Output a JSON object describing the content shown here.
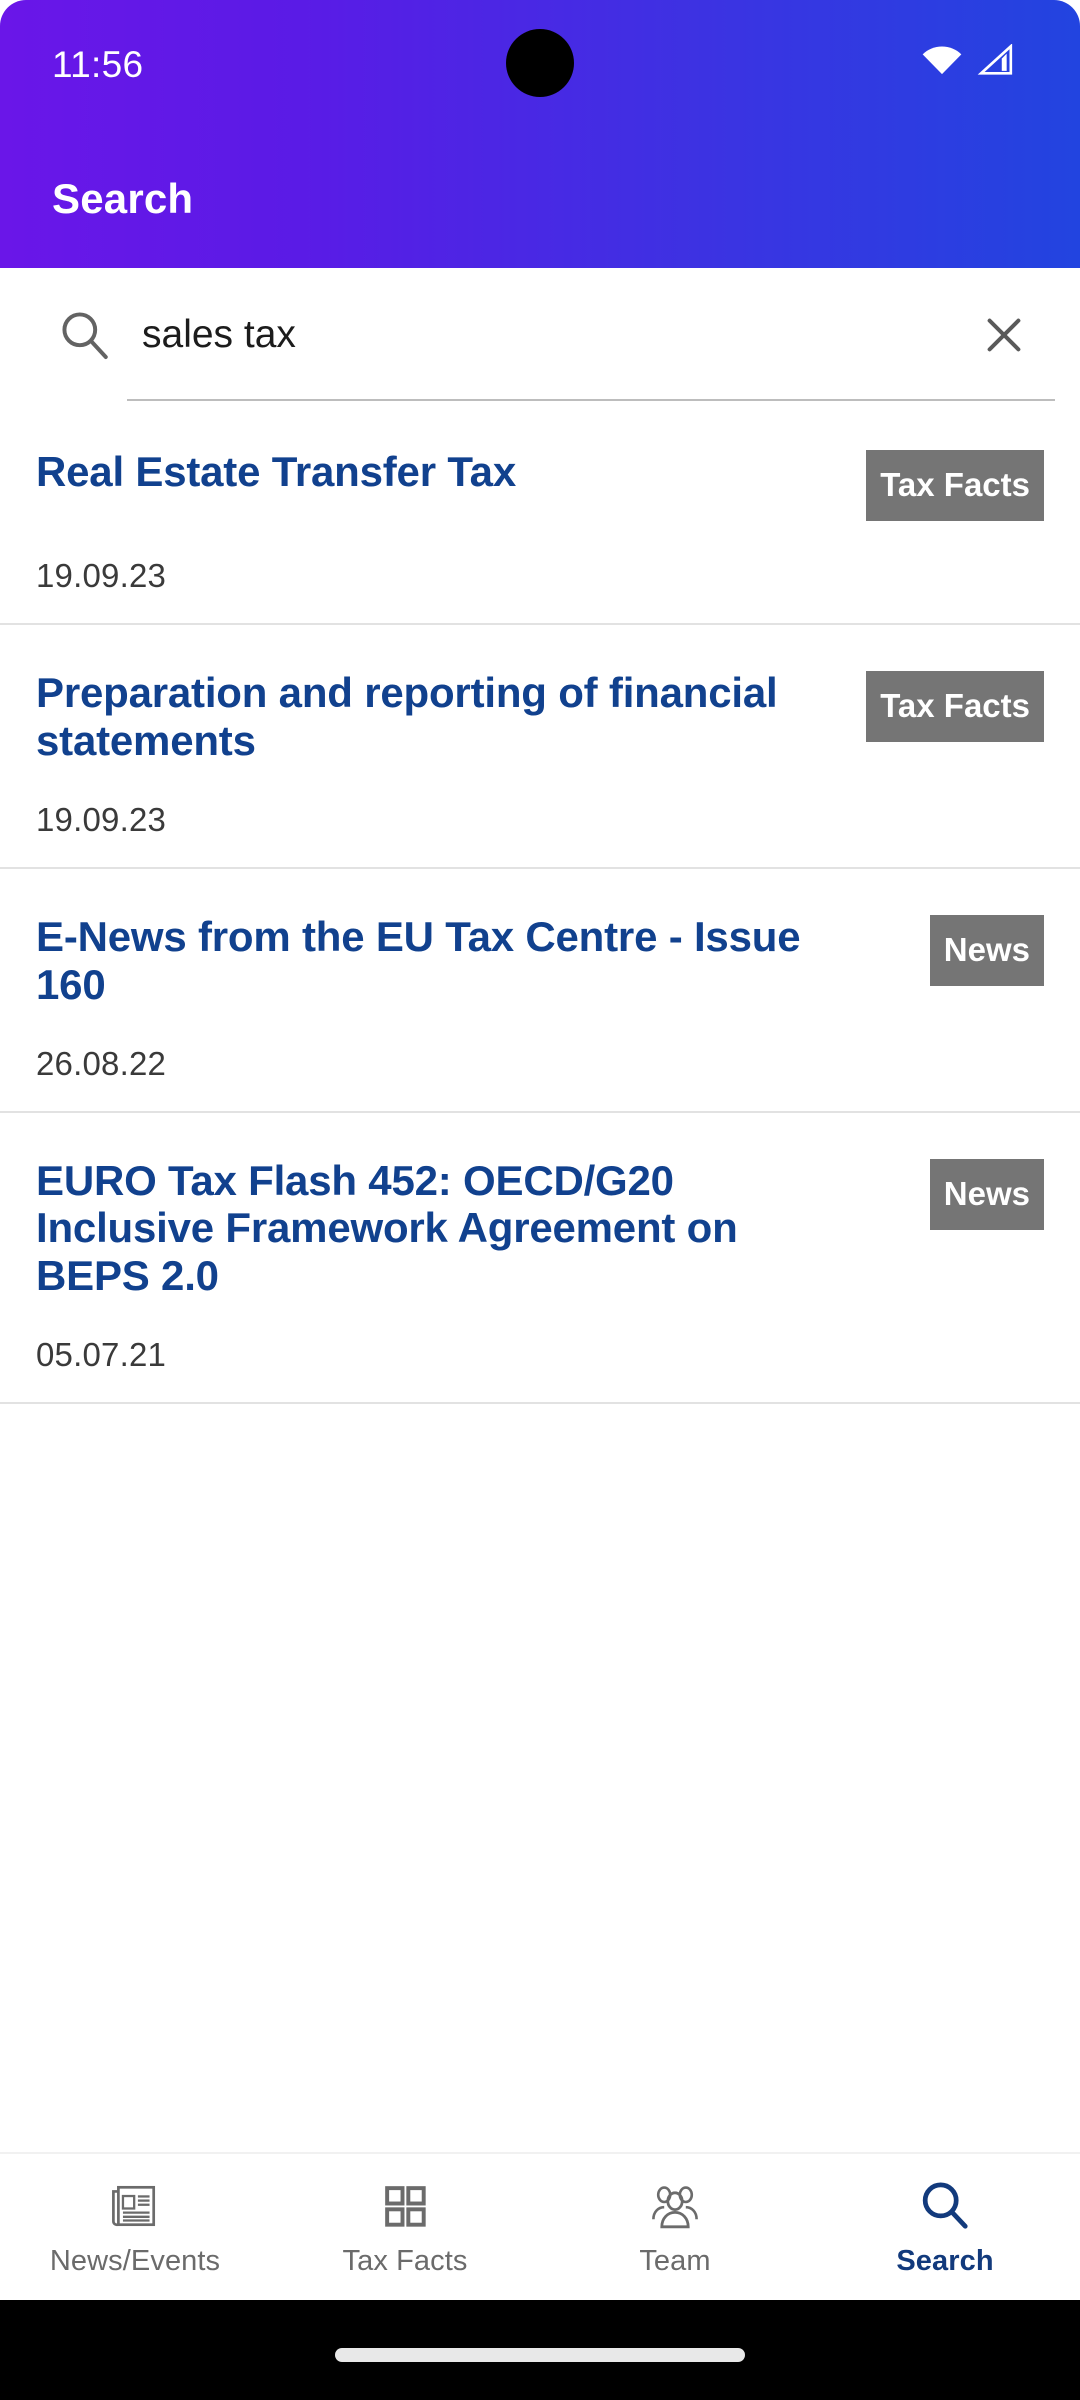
{
  "status_bar": {
    "time": "11:56",
    "wifi_icon": "wifi-icon",
    "signal_icon": "cellular-signal-icon",
    "camera_cutout": "front-camera-cutout"
  },
  "header": {
    "title": "Search",
    "gradient_start": "#6A16E8",
    "gradient_end": "#2244E0"
  },
  "search": {
    "value": "sales tax",
    "placeholder": "Search",
    "search_icon": "search-icon",
    "clear_icon": "close-icon"
  },
  "results": [
    {
      "title": "Real Estate Transfer Tax",
      "badge": "Tax Facts",
      "date": "19.09.23"
    },
    {
      "title": "Preparation and reporting of financial statements",
      "badge": "Tax Facts",
      "date": "19.09.23"
    },
    {
      "title": "E-News from the EU Tax Centre - Issue 160",
      "badge": "News",
      "date": "26.08.22"
    },
    {
      "title": "EURO Tax Flash 452: OECD/G20 Inclusive Framework Agreement on BEPS 2.0",
      "badge": "News",
      "date": "05.07.21"
    }
  ],
  "colors": {
    "result_title": "#11418E",
    "badge_bg": "#757575",
    "nav_active": "#123A7C",
    "nav_inactive": "#6B6B6B"
  },
  "bottom_nav": {
    "items": [
      {
        "label": "News/Events",
        "icon": "newspaper-icon",
        "active": false
      },
      {
        "label": "Tax Facts",
        "icon": "grid-squares-icon",
        "active": false
      },
      {
        "label": "Team",
        "icon": "people-group-icon",
        "active": false
      },
      {
        "label": "Search",
        "icon": "search-icon",
        "active": true
      }
    ]
  }
}
